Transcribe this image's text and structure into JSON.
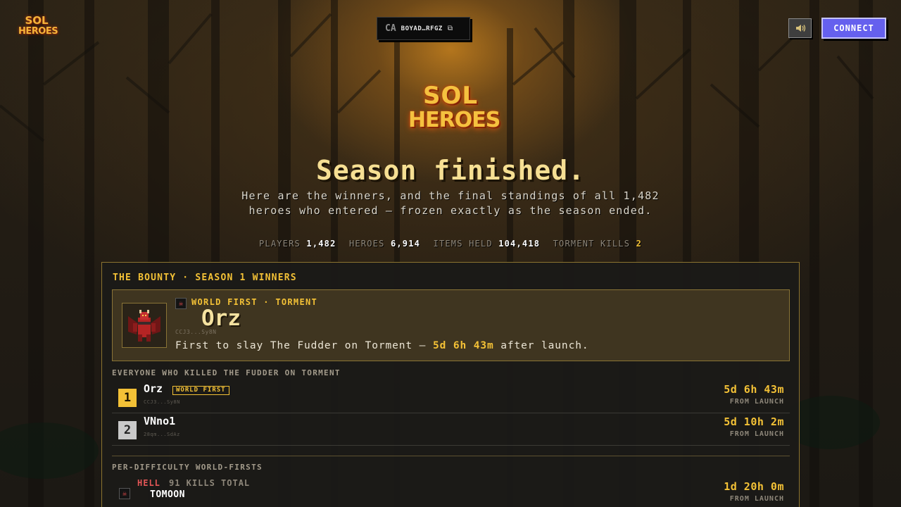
{
  "header": {
    "logo": {
      "line1": "SOL",
      "line2": "HEROES"
    },
    "contract": {
      "label": "CA",
      "value": "BOYAD…RFGZ"
    },
    "connect_label": "CONNECT"
  },
  "hero": {
    "logo": {
      "line1": "SOL",
      "line2": "HEROES"
    },
    "title": "Season finished.",
    "subtitle": "Here are the winners, and the final standings of all 1,482 heroes who entered — frozen exactly as the season ended.",
    "stats": [
      {
        "label": "PLAYERS",
        "value": "1,482"
      },
      {
        "label": "HEROES",
        "value": "6,914"
      },
      {
        "label": "ITEMS HELD",
        "value": "104,418"
      },
      {
        "label": "TORMENT KILLS",
        "value": "2"
      }
    ]
  },
  "bounty": {
    "heading": "THE BOUNTY · SEASON 1 WINNERS",
    "champion": {
      "tag": "WORLD FIRST · TORMENT",
      "name": "Orz",
      "wallet": "CCJ3...Sy8N",
      "desc_pre": "First to slay The Fudder on Torment —",
      "desc_time": "5d 6h 43m",
      "desc_post": "after launch."
    },
    "torment_heading": "EVERYONE WHO KILLED THE FUDDER ON TORMENT",
    "torment_kills": [
      {
        "rank": "1",
        "name": "Orz",
        "badge": "WORLD FIRST",
        "wallet": "CCJ3...Sy8N",
        "time": "5d 6h 43m",
        "sub": "FROM LAUNCH"
      },
      {
        "rank": "2",
        "name": "VNno1",
        "badge": "",
        "wallet": "28qm...SdAz",
        "time": "5d 10h 2m",
        "sub": "FROM LAUNCH"
      }
    ],
    "difficulty_heading": "PER-DIFFICULTY WORLD-FIRSTS",
    "difficulty_firsts": [
      {
        "difficulty": "HELL",
        "kills": "91 KILLS TOTAL",
        "player": "TOMOON",
        "time": "1d 20h 0m",
        "sub": "FROM LAUNCH"
      }
    ]
  },
  "colors": {
    "accent_gold": "#f3c136",
    "connect_purple": "#6560ee",
    "hell_red": "#e35656",
    "panel_border": "#8c7430"
  },
  "icons": [
    "copy-icon",
    "speaker-icon",
    "skull-icon"
  ]
}
